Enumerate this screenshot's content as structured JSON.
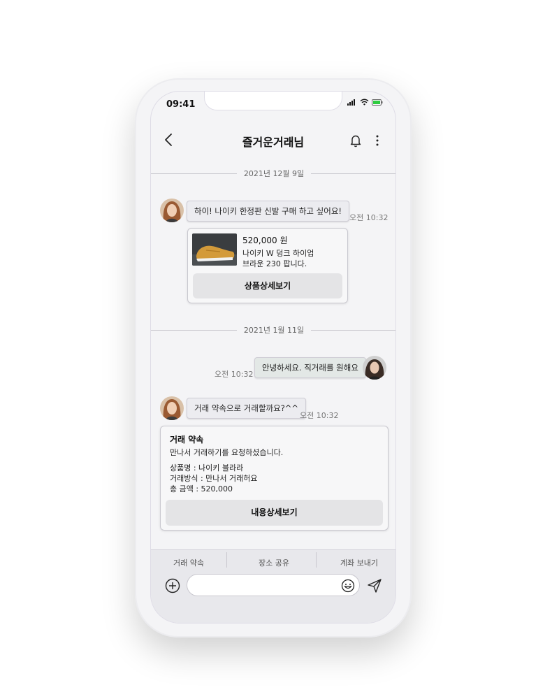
{
  "status_bar": {
    "time": "09:41"
  },
  "header": {
    "title": "즐거운거래님"
  },
  "dates": {
    "first": "2021년 12월 9일",
    "second": "2021년 1월 11일"
  },
  "messages": [
    {
      "text": "하이! 나이키 한정판 신발 구매 하고 싶어요!",
      "time": "오전 10:32"
    },
    {
      "text": "안녕하세요. 직거래를 원해요",
      "time": "오전 10:32"
    },
    {
      "text": "거래 약속으로 거래할까요?^^",
      "time": "오전 10:32"
    }
  ],
  "product_card": {
    "price": "520,000 원",
    "desc_line1": "나이키 W 덩크 하이업",
    "desc_line2": "브라운 230 팝니다.",
    "button": "상품상세보기"
  },
  "promise_card": {
    "title": "거래 약속",
    "subtitle": "만나서 거래하기를 요청하셨습니다.",
    "product_name": "상품명 : 나이키 블라라",
    "method": "거래방식 : 만나서 거래허요",
    "total": "총 금액 : 520,000",
    "button": "내용상세보기"
  },
  "toolbar": {
    "promise": "거래 약속",
    "location": "장소 공유",
    "transfer": "계좌 보내기"
  },
  "colors": {
    "battery": "#2ecc40",
    "accent_bubble_mine": "#e3e8e6",
    "bubble_other": "#ececf0"
  }
}
